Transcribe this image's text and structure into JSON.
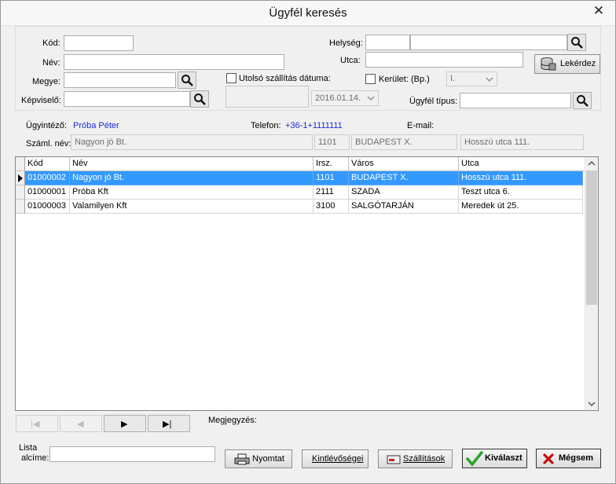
{
  "window": {
    "title": "Ügyfél keresés",
    "close_glyph": "✕"
  },
  "filters": {
    "kod_label": "Kód:",
    "nev_label": "Név:",
    "megye_label": "Megye:",
    "kepviselo_label": "Képviselő:",
    "helyseg_label": "Helység:",
    "utca_label": "Utca:",
    "kerulet_label": "Kerület: (Bp.)",
    "kerulet_value": "I.",
    "utolso_szallitas_label": "Utolsó szállítás dátuma:",
    "utolso_szallitas_value": "2016.01.14.",
    "ugyfel_tipus_label": "Ügyfél típus:",
    "lekerdez_label": "Lekérdez"
  },
  "details": {
    "ugyintezo_label": "Ügyintéző:",
    "ugyintezo_value": "Próba Péter",
    "telefon_label": "Telefon:",
    "telefon_value": "+36-1+1111111",
    "email_label": "E-mail:",
    "szaml_nev_label": "Száml. név:",
    "szaml_nev_value": "Nagyon jó Bt.",
    "irsz_value": "1101",
    "varos_value": "BUDAPEST X.",
    "utca_value": "Hosszú utca 111."
  },
  "table": {
    "columns": [
      "Kód",
      "Név",
      "Irsz.",
      "Város",
      "Utca"
    ],
    "rows": [
      [
        "01000002",
        "Nagyon jó Bt.",
        "1101",
        "BUDAPEST X.",
        "Hosszú utca 111."
      ],
      [
        "01000001",
        "Próba Kft",
        "2111",
        "SZADA",
        "Teszt utca 6."
      ],
      [
        "01000003",
        "Valamilyen Kft",
        "3100",
        "SALGÓTARJÁN",
        "Meredek út 25."
      ]
    ],
    "selected_row": 0
  },
  "nav": {
    "first": "|◀",
    "prev": "◀",
    "next": "▶",
    "last": "▶|",
    "megjegyzes_label": "Megjegyzés:"
  },
  "footer": {
    "lista_label_line1": "Lista",
    "lista_label_line2": "alcíme:",
    "nyomtat_label": "Nyomtat",
    "kintlevosegei_label": "Kintlévőségei",
    "szallitasok_label": "Szállítások",
    "kivalaszt_label": "Kiválaszt",
    "megsem_label": "Mégsem"
  },
  "colors": {
    "selection": "#3399ff",
    "link_blue": "#1a2bd6",
    "ok_green": "#2aa12a",
    "cancel_red": "#c41010"
  },
  "icons": [
    "search-icon",
    "database-icon",
    "printer-icon",
    "envelope-icon",
    "checkmark-icon",
    "x-icon",
    "close-icon",
    "chevron-down-icon"
  ]
}
